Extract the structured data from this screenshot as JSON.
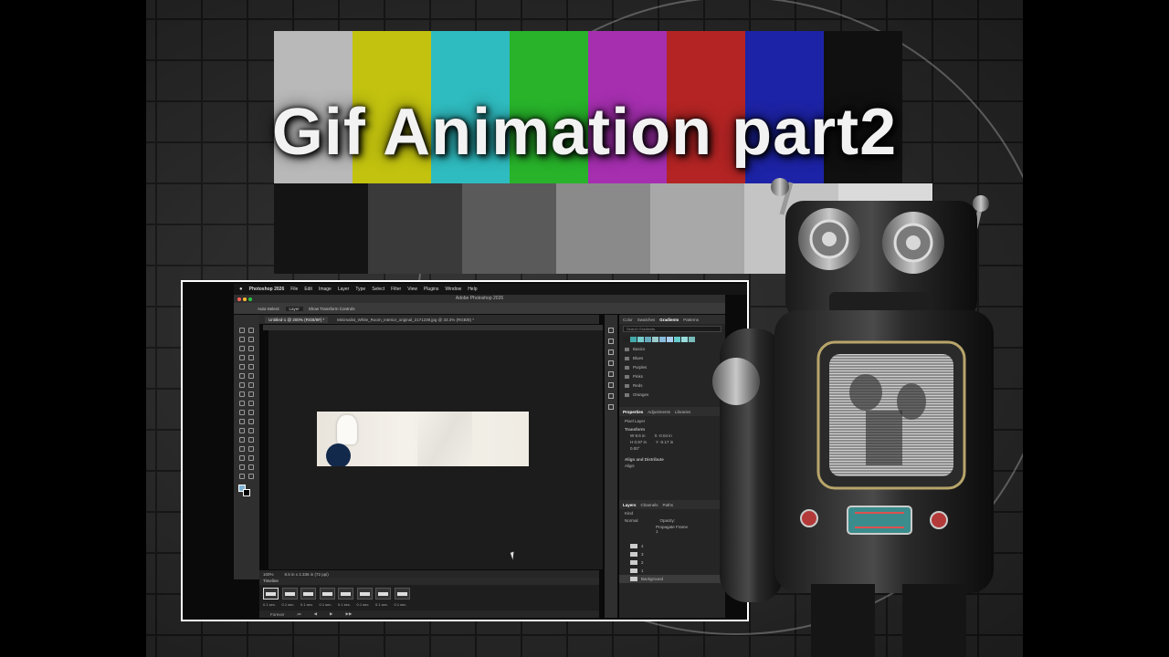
{
  "thumbnail": {
    "title": "Gif Animation part2",
    "colors": {
      "top_bars": [
        "#b9b9b9",
        "#c2c20f",
        "#2fbcc0",
        "#28b32a",
        "#a62fb0",
        "#b52424",
        "#1d23a6",
        "#101010"
      ],
      "bottom_bars": [
        "#141414",
        "#3a3a3a",
        "#5a5a5a",
        "#8a8a8a",
        "#a8a8a8",
        "#c4c4c4",
        "#dadada"
      ]
    }
  },
  "photoshop": {
    "menubar": {
      "app_name": "Photoshop 2026",
      "items": [
        "File",
        "Edit",
        "Image",
        "Layer",
        "Type",
        "Select",
        "Filter",
        "View",
        "Plugins",
        "Window",
        "Help"
      ]
    },
    "window_title": "Adobe Photoshop 2026",
    "options_bar": {
      "auto_select": "Auto-Select:",
      "layer_select": "Layer",
      "show_transform": "Show Transform Controls"
    },
    "doc_tabs": [
      "Untitled-1 @ 200% (RGB/8#) *",
      "Minimalist_White_Room_Interior_original_2171239.jpg @ 33.3% (RGB/8) *"
    ],
    "status": {
      "zoom": "100%",
      "doc_size": "8.5 in x 2.336 in (72 ppi)"
    },
    "timeline": {
      "label": "Timeline",
      "frames": [
        {
          "num": "1",
          "delay": "0.1 sec."
        },
        {
          "num": "2",
          "delay": "0.1 sec."
        },
        {
          "num": "3",
          "delay": "0.1 sec."
        },
        {
          "num": "4",
          "delay": "0.1 sec."
        },
        {
          "num": "5",
          "delay": "0.1 sec."
        },
        {
          "num": "6",
          "delay": "0.1 sec."
        },
        {
          "num": "7",
          "delay": "0.1 sec."
        },
        {
          "num": "8",
          "delay": "0.1 sec."
        }
      ],
      "loop": "Forever"
    },
    "panels": {
      "top_tabs": [
        "Color",
        "Swatches",
        "Gradients",
        "Patterns"
      ],
      "search_placeholder": "Search Gradients",
      "gradient_folders": [
        "Basics",
        "Blues",
        "Purples",
        "Pinks",
        "Reds",
        "Oranges"
      ],
      "properties_tabs": [
        "Properties",
        "Adjustments",
        "Libraries"
      ],
      "pixel_layer": "Pixel Layer",
      "transform_label": "Transform",
      "transform_values": {
        "w": "8.6 in",
        "x": "-0.04 in",
        "h": "0.97 in",
        "y": "-0.17 in",
        "angle": "0.00°"
      },
      "align_label": "Align and Distribute",
      "align_sub": "Align:",
      "layers_tabs": [
        "Layers",
        "Channels",
        "Paths"
      ],
      "layer_kind": "Kind",
      "blend_mode": "Normal",
      "opacity": "Opacity:",
      "propagate": "Propagate Frame 1",
      "layers": [
        "4",
        "3",
        "2",
        "1",
        "Background"
      ]
    }
  }
}
